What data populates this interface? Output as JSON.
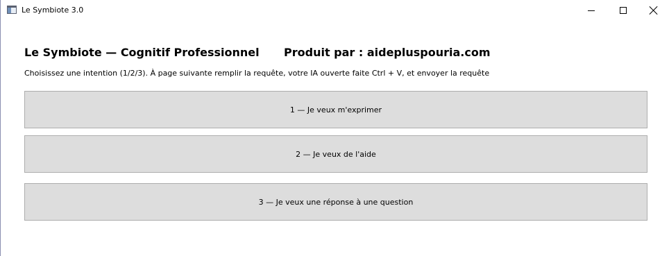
{
  "window": {
    "title": "Le Symbiote 3.0",
    "icon": "app-window-icon",
    "controls": [
      "minimize-icon",
      "maximize-icon",
      "close-icon"
    ]
  },
  "header": {
    "app_title": "Le Symbiote — Cognitif Professionnel",
    "producer": "Produit par : aidepluspouria.com"
  },
  "instructions": "Choisissez une intention (1/2/3). À page suivante remplir la requête, votre IA ouverte faite Ctrl + V, et envoyer la requête",
  "intents": [
    {
      "label": "1 — Je veux m'exprimer"
    },
    {
      "label": "2 — Je veux de l'aide"
    },
    {
      "label": "3 — Je veux une réponse à une question"
    }
  ],
  "colors": {
    "button_bg": "#dddddd",
    "button_border": "#adadad",
    "window_bg": "#ffffff"
  }
}
